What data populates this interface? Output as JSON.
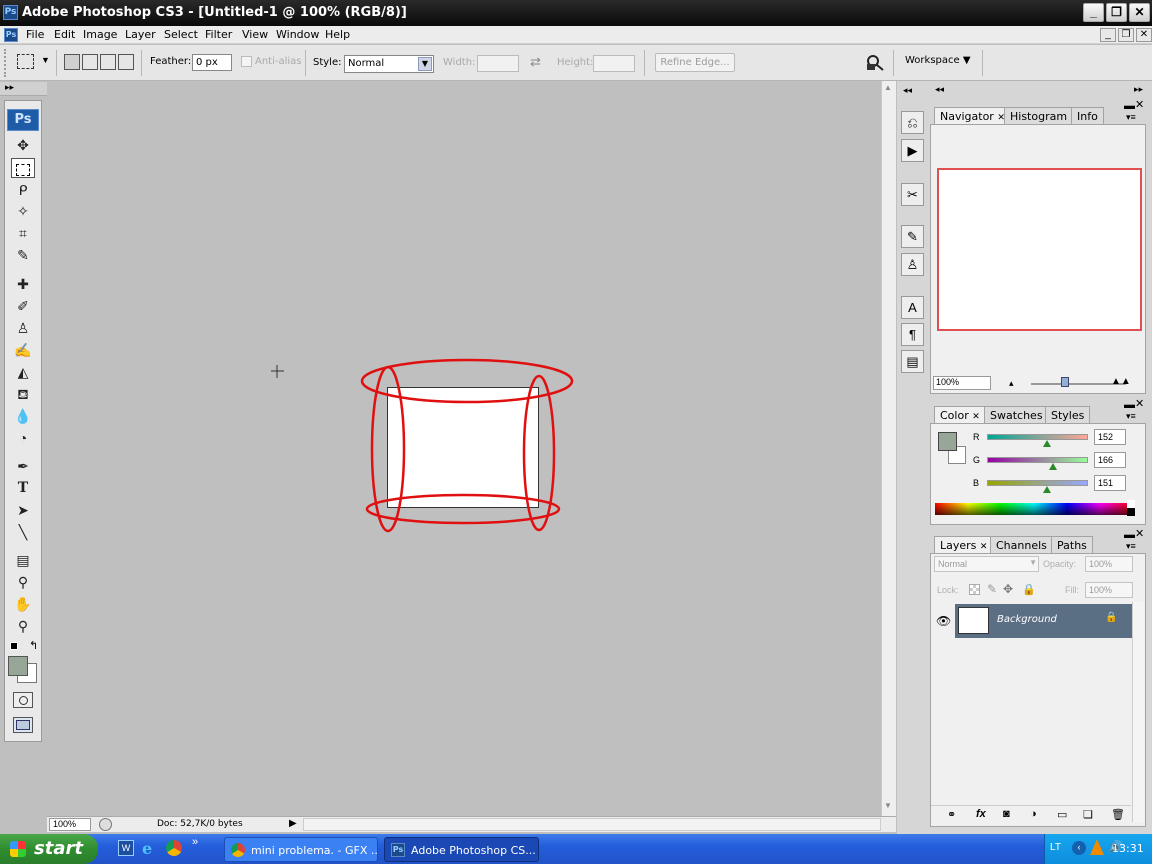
{
  "window": {
    "app_icon": "Ps",
    "title": "Adobe Photoshop CS3 - [Untitled-1 @ 100% (RGB/8)]",
    "controls": [
      "_",
      "❐",
      "✕"
    ]
  },
  "menu": {
    "items": [
      "File",
      "Edit",
      "Image",
      "Layer",
      "Select",
      "Filter",
      "View",
      "Window",
      "Help"
    ]
  },
  "options": {
    "feather_label": "Feather:",
    "feather_value": "0 px",
    "anti_alias_label": "Anti-alias",
    "style_label": "Style:",
    "style_value": "Normal",
    "width_label": "Width:",
    "height_label": "Height:",
    "refine_edge_label": "Refine Edge...",
    "workspace_label": "Workspace"
  },
  "toolbox": {
    "logo": "Ps"
  },
  "status": {
    "zoom": "100%",
    "doc": "Doc: 52,7K/0 bytes"
  },
  "navigator": {
    "tabs": [
      "Navigator",
      "Histogram",
      "Info"
    ],
    "zoom": "100%"
  },
  "color": {
    "tabs": [
      "Color",
      "Swatches",
      "Styles"
    ],
    "channels": [
      {
        "label": "R",
        "value": "152",
        "level": 152
      },
      {
        "label": "G",
        "value": "166",
        "level": 166
      },
      {
        "label": "B",
        "value": "151",
        "level": 151
      }
    ],
    "foreground": "#98a697"
  },
  "layers": {
    "tabs": [
      "Layers",
      "Channels",
      "Paths"
    ],
    "blend_mode": "Normal",
    "opacity_label": "Opacity:",
    "opacity_value": "100%",
    "lock_label": "Lock:",
    "fill_label": "Fill:",
    "fill_value": "100%",
    "items": [
      {
        "name": "Background"
      }
    ]
  },
  "taskbar": {
    "start": "start",
    "items": [
      "mini problema. - GFX ...",
      "Adobe Photoshop CS..."
    ],
    "lang": "LT",
    "clock": "13:31"
  },
  "colors": {
    "annotation": "#e01010",
    "layer_selected": "#5b6f84",
    "taskbar": "#245edb"
  }
}
